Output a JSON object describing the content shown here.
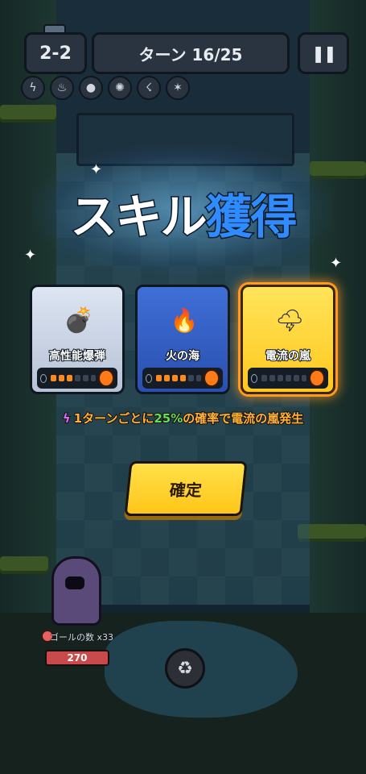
{
  "hud": {
    "stage": "2-2",
    "turns": "ターン 16/25",
    "pause_icon": "pause-icon",
    "status_icons": [
      "lightning-icon",
      "fire-icon",
      "bomb-icon",
      "spark-bomb-icon",
      "storm-icon",
      "claw-icon"
    ]
  },
  "popup": {
    "title_part1": "スキル",
    "title_part2": "獲得",
    "skills": [
      {
        "name": "高性能爆弾",
        "icon": "bomb-icon",
        "level": 1,
        "max_level": 6
      },
      {
        "name": "火の海",
        "icon": "fire-icon",
        "level": 3,
        "max_level": 6
      },
      {
        "name": "電流の嵐",
        "icon": "storm-cloud-icon",
        "level": 0,
        "max_level": 6,
        "selected": true
      }
    ],
    "description_pre": "1ターンごとに",
    "description_pct": "25%",
    "description_post": "の確率で電流の嵐発生",
    "confirm_label": "確定"
  },
  "player": {
    "goal_label": "ゴールの数",
    "goal_count": "x33",
    "hp": "270"
  },
  "colors": {
    "accent_blue": "#2f8cff",
    "selected_gold": "#ffc81e",
    "percent_green": "#5fe05a",
    "desc_orange": "#ffb23a"
  }
}
